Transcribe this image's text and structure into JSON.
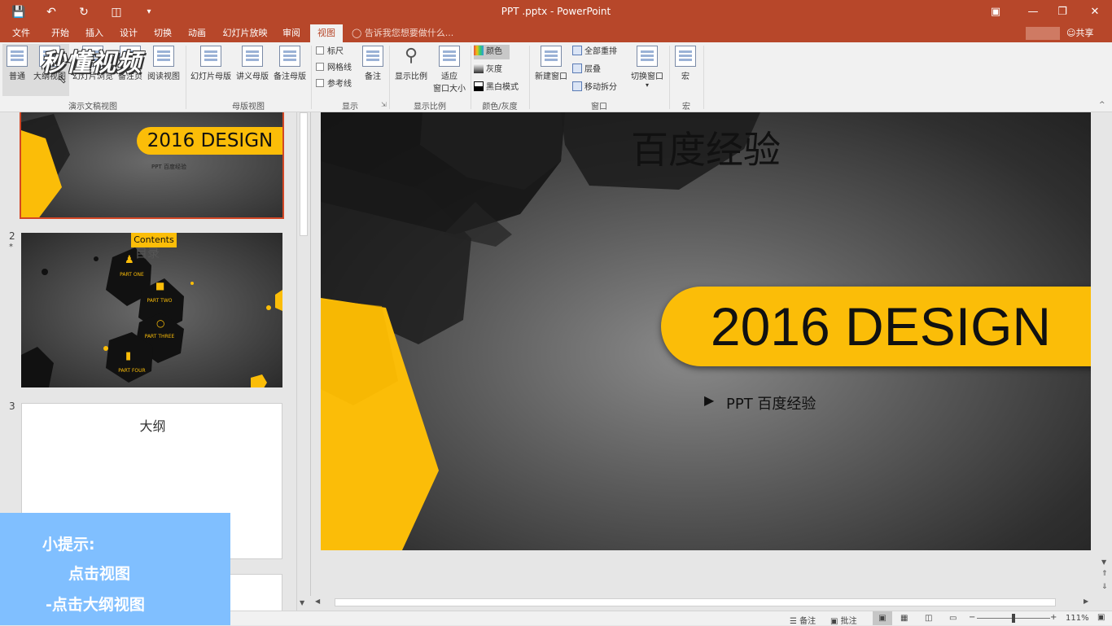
{
  "window": {
    "title": "PPT .pptx - PowerPoint",
    "share_label": "共享"
  },
  "tabs": [
    {
      "label": "文件"
    },
    {
      "label": "开始"
    },
    {
      "label": "插入"
    },
    {
      "label": "设计"
    },
    {
      "label": "切换"
    },
    {
      "label": "动画"
    },
    {
      "label": "幻灯片放映"
    },
    {
      "label": "审阅"
    },
    {
      "label": "视图",
      "active": true
    }
  ],
  "tell_me_placeholder": "告诉我您想要做什么...",
  "ribbon": {
    "presentation_views": {
      "group_label": "演示文稿视图",
      "buttons": [
        "普通",
        "大纲视图",
        "幻灯片浏览",
        "备注页",
        "阅读视图"
      ]
    },
    "master_views": {
      "group_label": "母版视图",
      "buttons": [
        "幻灯片母版",
        "讲义母版",
        "备注母版"
      ]
    },
    "show": {
      "group_label": "显示",
      "checkboxes": [
        "标尺",
        "网格线",
        "参考线"
      ],
      "notes_button": "备注"
    },
    "zoom": {
      "group_label": "显示比例",
      "zoom_button": "显示比例",
      "fit_button_line1": "适应",
      "fit_button_line2": "窗口大小"
    },
    "color": {
      "group_label": "颜色/灰度",
      "options": [
        "颜色",
        "灰度",
        "黑白模式"
      ]
    },
    "window": {
      "group_label": "窗口",
      "new_window": "新建窗口",
      "options": [
        "全部重排",
        "层叠",
        "移动拆分"
      ]
    },
    "switch": {
      "label": "切换窗口"
    },
    "macros": {
      "group_label": "宏",
      "button": "宏"
    }
  },
  "watermark": "秒懂视频",
  "thumbnails": {
    "slide1": {
      "title": "2016 DESIGN",
      "subtitle": "PPT 百度经验"
    },
    "slide2": {
      "number": "2",
      "star": "*",
      "banner": "Contents",
      "title": "目录",
      "parts": [
        "PART ONE",
        "PART TWO",
        "PART THREE",
        "PART FOUR"
      ]
    },
    "slide3": {
      "number": "3",
      "title": "大纲"
    }
  },
  "slide": {
    "title": "百度经验",
    "banner": "2016 DESIGN",
    "subtitle": "PPT 百度经验"
  },
  "status": {
    "notes": "备注",
    "comments": "批注",
    "zoom": "111%"
  },
  "tip": {
    "line1": "小提示:",
    "line2": "点击视图",
    "line3": "-点击大纲视图"
  },
  "colors": {
    "accent": "#b7472a",
    "yellow": "#fbbd08",
    "tip_bg": "#80bfff"
  }
}
